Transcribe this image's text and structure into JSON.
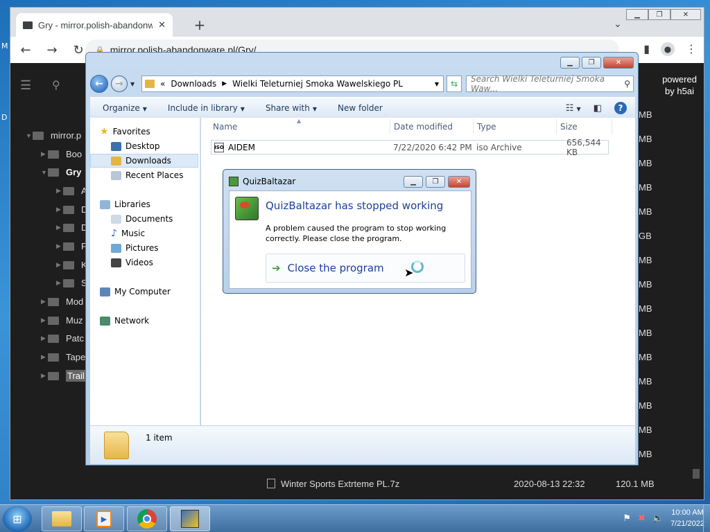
{
  "browser": {
    "tab_title": "Gry - mirror.polish-abandonware",
    "url": "mirror.polish-abandonware.pl/Gry/",
    "new_tab": "+",
    "tab_search": "⌄"
  },
  "h5ai": {
    "powered_line1": "powered",
    "powered_line2": "by h5ai",
    "left_letters": [
      "M",
      "D"
    ],
    "tree": [
      {
        "label": "mirror.p",
        "level": 0,
        "open": true
      },
      {
        "label": "Boo",
        "level": 1,
        "open": false
      },
      {
        "label": "Gry",
        "level": 1,
        "open": true,
        "bold": true
      },
      {
        "label": "A",
        "level": 2
      },
      {
        "label": "D",
        "level": 2
      },
      {
        "label": "D",
        "level": 2
      },
      {
        "label": "F",
        "level": 2
      },
      {
        "label": "K",
        "level": 2
      },
      {
        "label": "S",
        "level": 2
      },
      {
        "label": "Mod",
        "level": 1
      },
      {
        "label": "Muz",
        "level": 1
      },
      {
        "label": "Patc",
        "level": 1
      },
      {
        "label": "Tape",
        "level": 1
      },
      {
        "label": "Trail",
        "level": 1,
        "selected": true
      }
    ],
    "right_sizes": [
      "MB",
      "MB",
      "MB",
      "MB",
      "MB",
      "GB",
      "MB",
      "MB",
      "MB",
      "MB",
      "MB",
      "MB",
      "MB",
      "MB",
      "MB"
    ],
    "last_row": {
      "name": "Winter Sports Extrteme PL.7z",
      "date": "2020-08-13 22:32",
      "size": "120.1 MB"
    }
  },
  "explorer": {
    "breadcrumb_prefix": "«",
    "breadcrumb": [
      "Downloads",
      "Wielki Teleturniej Smoka Wawelskiego PL"
    ],
    "search_placeholder": "Search Wielki Teleturniej Smoka Waw...",
    "commands": [
      "Organize",
      "Include in library",
      "Share with",
      "New folder"
    ],
    "nav": {
      "favorites": "Favorites",
      "desktop": "Desktop",
      "downloads": "Downloads",
      "recent": "Recent Places",
      "libraries": "Libraries",
      "documents": "Documents",
      "music": "Music",
      "pictures": "Pictures",
      "videos": "Videos",
      "computer": "My Computer",
      "network": "Network"
    },
    "columns": [
      "Name",
      "Date modified",
      "Type",
      "Size"
    ],
    "files": [
      {
        "name": "AIDEM",
        "date": "7/22/2020 6:42 PM",
        "type": "iso Archive",
        "size": "656,544 KB",
        "icon_label": "ISO"
      }
    ],
    "status": "1 item"
  },
  "dialog": {
    "title": "QuizBaltazar",
    "heading": "QuizBaltazar has stopped working",
    "message": "A problem caused the program to stop working correctly. Please close the program.",
    "close_label": "Close the program"
  },
  "taskbar": {
    "time": "10:00 AM",
    "date": "7/21/2022"
  },
  "colors": {
    "accent": "#1c3f9a",
    "taskbar": "#4a7bab",
    "page_bg": "#1e1e1e"
  }
}
